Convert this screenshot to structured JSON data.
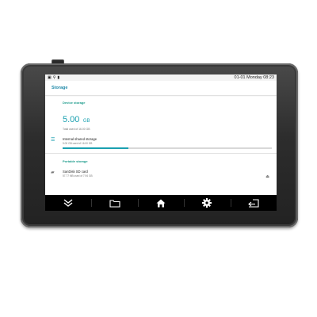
{
  "status_bar": {
    "icons": [
      "image-icon",
      "location-icon",
      "battery-icon"
    ],
    "datetime": "01-01 Monday 08:23"
  },
  "app_bar": {
    "title": "Storage"
  },
  "device_storage": {
    "header": "Device storage",
    "total_value": "5.00",
    "total_unit": "GB",
    "total_used_text": "Total used of 16.00 GB",
    "internal": {
      "title": "Internal shared storage",
      "subtitle": "5.00 GB used of 16.00 GB",
      "used_fraction": 0.3125
    }
  },
  "portable_storage": {
    "header": "Portable storage",
    "sd_card": {
      "title": "SanDisk SD card",
      "subtitle": "57.77 MB used of 7.94 GB"
    }
  },
  "nav_bar": {
    "buttons": [
      "chevron-down-icon",
      "folder-icon",
      "home-icon",
      "settings-gear-icon",
      "back-icon"
    ]
  },
  "colors": {
    "accent": "#1aa0b0",
    "header_text": "#1a9a8a",
    "nav_bg": "#000000",
    "bezel": "#2d2d2d"
  }
}
